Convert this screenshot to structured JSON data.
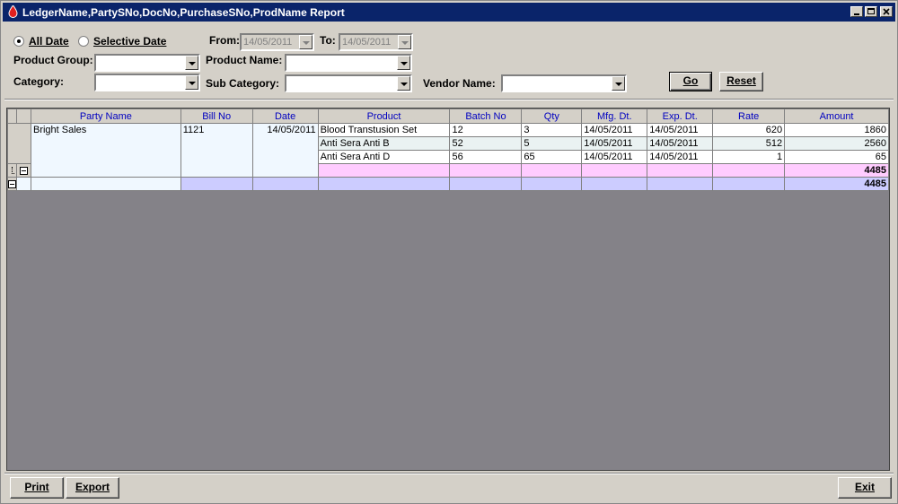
{
  "window": {
    "title": "LedgerName,PartySNo,DocNo,PurchaseSNo,ProdName Report"
  },
  "filters": {
    "all_date_label": "All Date",
    "selective_date_label": "Selective Date",
    "from_label": "From:",
    "from_value": "14/05/2011",
    "to_label": "To:",
    "to_value": "14/05/2011",
    "product_group_label": "Product Group:",
    "product_name_label": "Product Name:",
    "category_label": "Category:",
    "sub_category_label": "Sub Category:",
    "vendor_name_label": "Vendor Name:",
    "go_label": "Go",
    "reset_label": "Reset"
  },
  "grid": {
    "columns": [
      "Party Name",
      "Bill No",
      "Date",
      "Product",
      "Batch No",
      "Qty",
      "Mfg. Dt.",
      "Exp. Dt.",
      "Rate",
      "Amount"
    ],
    "group": {
      "party_name": "Bright Sales",
      "bill_no": "1121",
      "date": "14/05/2011"
    },
    "rows": [
      {
        "product": "Blood Transtusion Set",
        "batch_no": "12",
        "qty": "3",
        "mfg": "14/05/2011",
        "exp": "14/05/2011",
        "rate": "620",
        "amount": "1860"
      },
      {
        "product": "Anti Sera Anti B",
        "batch_no": "52",
        "qty": "5",
        "mfg": "14/05/2011",
        "exp": "14/05/2011",
        "rate": "512",
        "amount": "2560"
      },
      {
        "product": "Anti Sera Anti D",
        "batch_no": "56",
        "qty": "65",
        "mfg": "14/05/2011",
        "exp": "14/05/2011",
        "rate": "1",
        "amount": "65"
      }
    ],
    "subtotal_amount": "4485",
    "total_amount": "4485"
  },
  "footer": {
    "print_label": "Print",
    "export_label": "Export",
    "exit_label": "Exit"
  },
  "colors": {
    "titlebar": "#0a246a",
    "header_text": "#0000c0",
    "subtotal_row": "#ffccff",
    "total_row": "#ccccff",
    "grid_background": "#848288"
  }
}
